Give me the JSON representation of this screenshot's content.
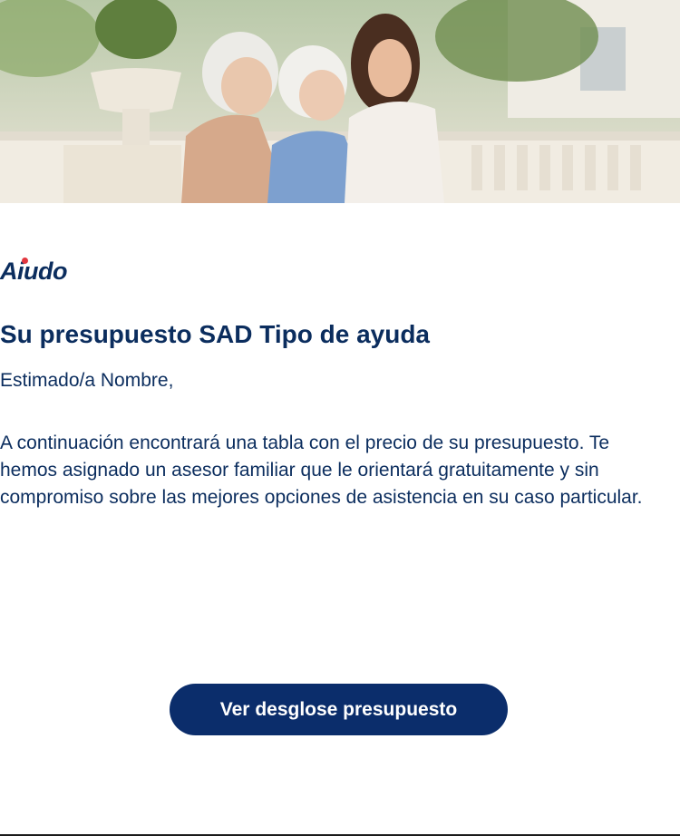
{
  "hero": {
    "image": "three-women-walking-terrace-photo"
  },
  "brand": {
    "logo_text": "Aiudo",
    "primary_color": "#0b2d5e",
    "accent_color": "#e2373f",
    "button_color": "#0b2d6b"
  },
  "email": {
    "title": "Su presupuesto SAD Tipo de ayuda",
    "greeting": "Estimado/a Nombre,",
    "body": "A continuación encontrará una tabla con el precio de su presupuesto. Te hemos asignado un asesor familiar que le orientará gratuitamente y sin compromiso sobre las mejores opciones de asistencia en su caso particular.",
    "cta_label": "Ver desglose presupuesto"
  }
}
